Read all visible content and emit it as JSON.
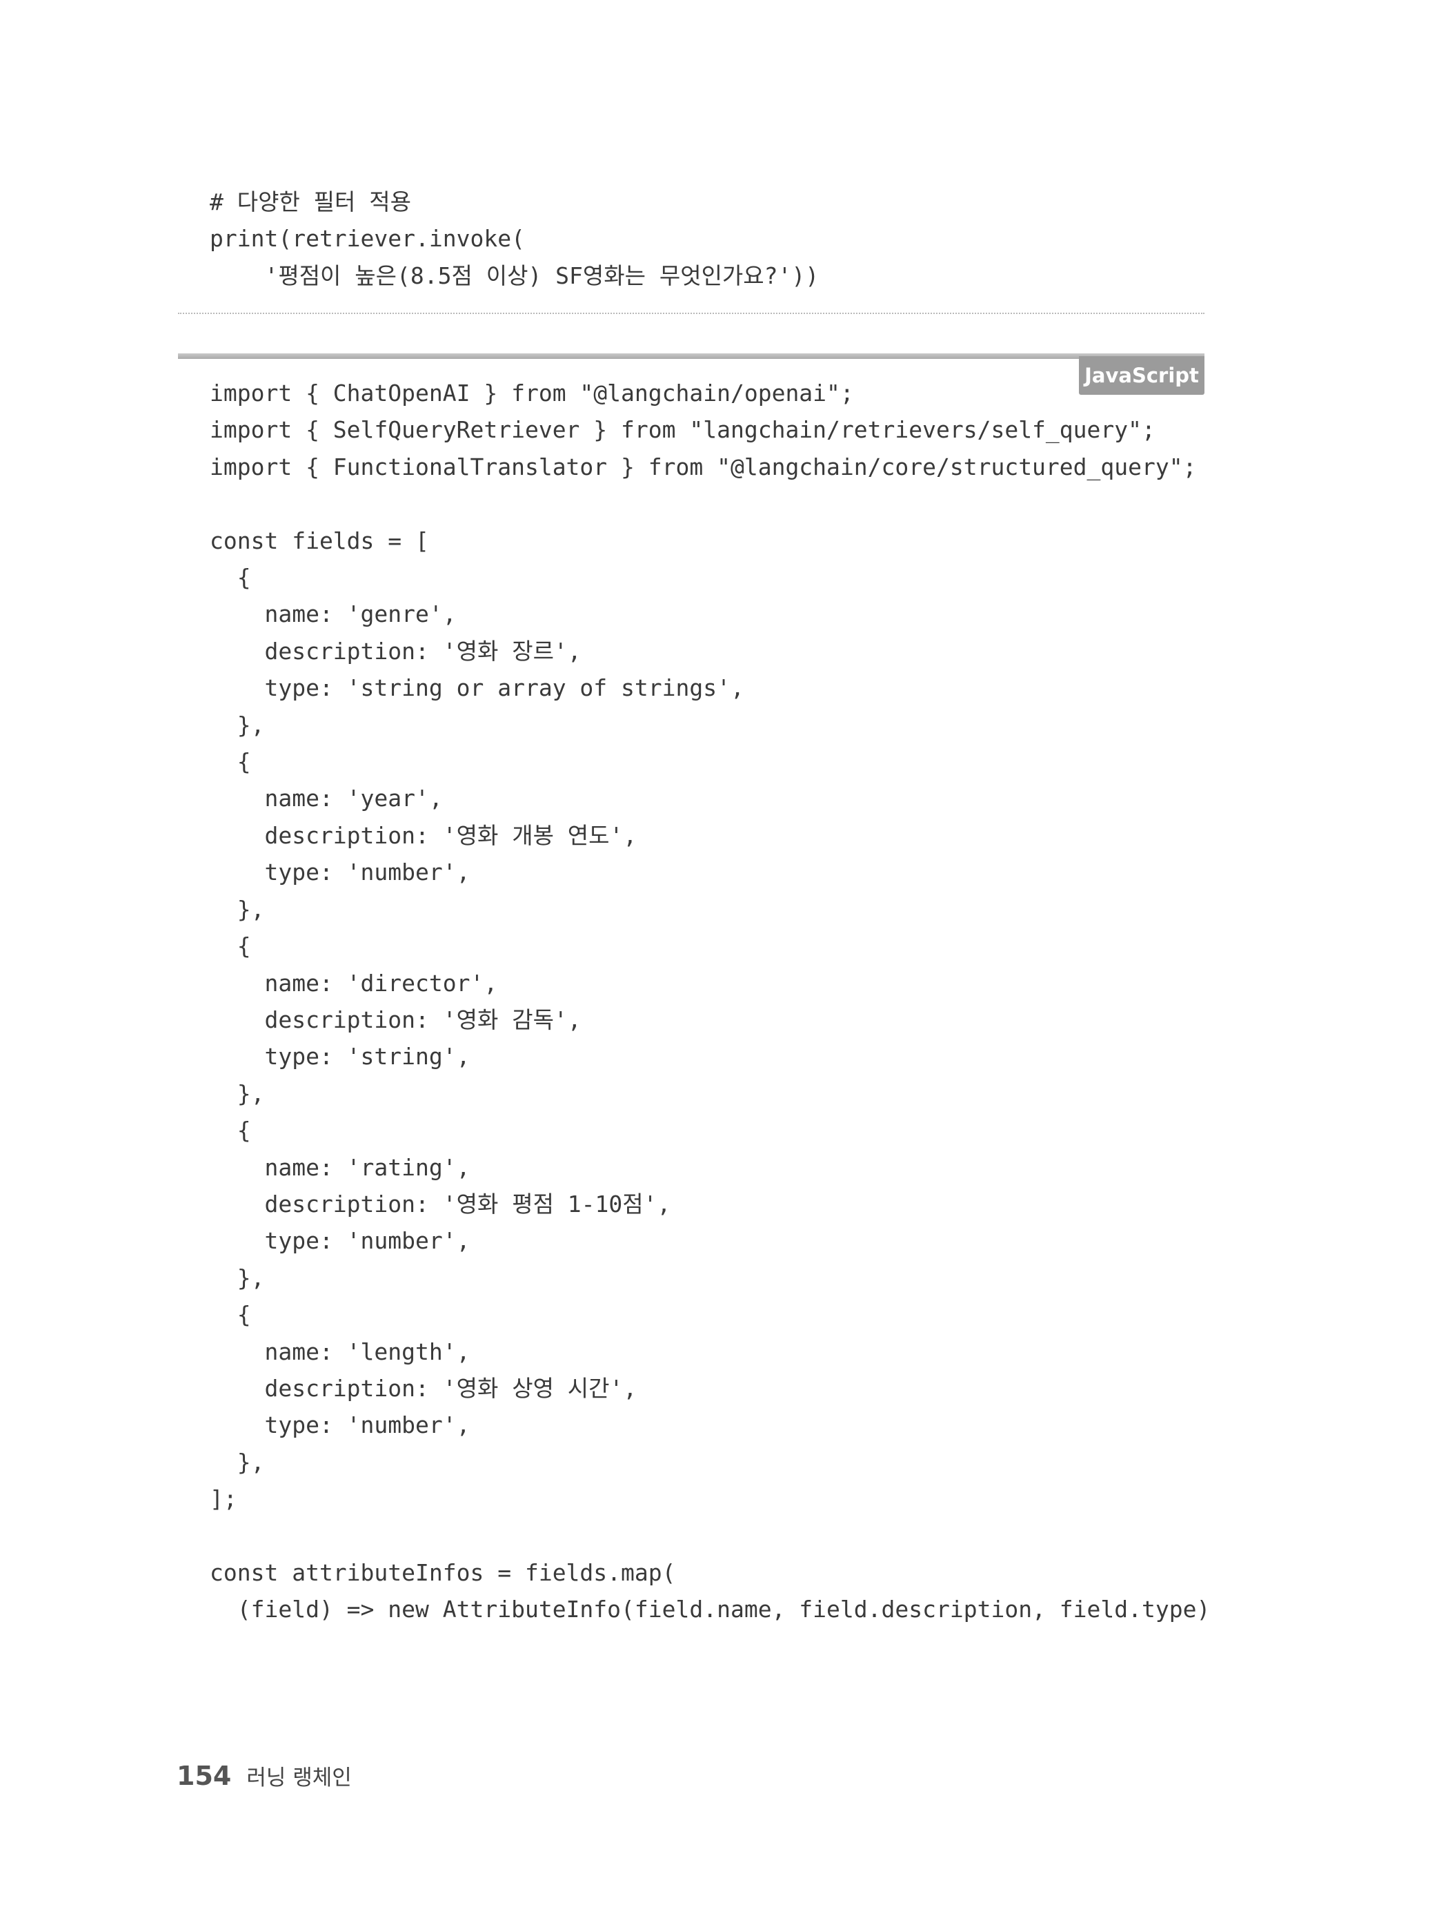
{
  "python_snippet": {
    "lines": [
      "# 다양한 필터 적용",
      "print(retriever.invoke(",
      "    '평점이 높은(8.5점 이상) SF영화는 무엇인가요?'))"
    ]
  },
  "js_block": {
    "language_label": "JavaScript",
    "lines": [
      "import { ChatOpenAI } from \"@langchain/openai\";",
      "import { SelfQueryRetriever } from \"langchain/retrievers/self_query\";",
      "import { FunctionalTranslator } from \"@langchain/core/structured_query\";",
      "",
      "const fields = [",
      "  {",
      "    name: 'genre',",
      "    description: '영화 장르',",
      "    type: 'string or array of strings',",
      "  },",
      "  {",
      "    name: 'year',",
      "    description: '영화 개봉 연도',",
      "    type: 'number',",
      "  },",
      "  {",
      "    name: 'director',",
      "    description: '영화 감독',",
      "    type: 'string',",
      "  },",
      "  {",
      "    name: 'rating',",
      "    description: '영화 평점 1-10점',",
      "    type: 'number',",
      "  },",
      "  {",
      "    name: 'length',",
      "    description: '영화 상영 시간',",
      "    type: 'number',",
      "  },",
      "];",
      "",
      "const attributeInfos = fields.map(",
      "  (field) => new AttributeInfo(field.name, field.description, field.type)"
    ]
  },
  "footer": {
    "page_number": "154",
    "book_title": "러닝 랭체인"
  }
}
